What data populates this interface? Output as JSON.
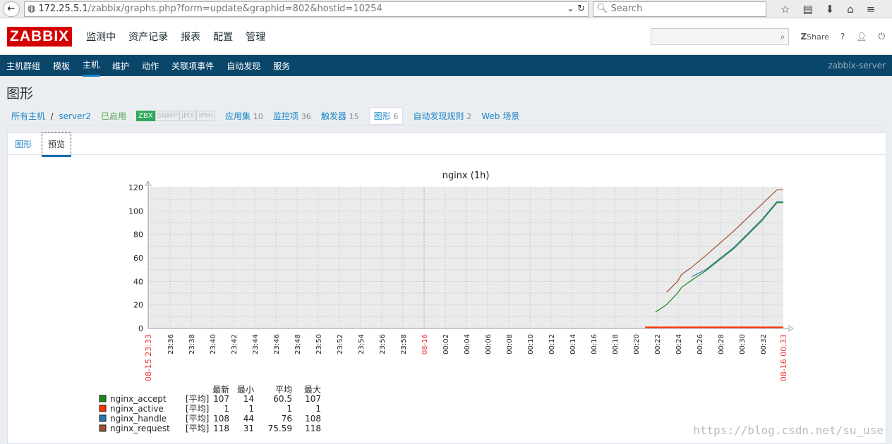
{
  "browser": {
    "url_host": "172.25.5.1",
    "url_path": "/zabbix/graphs.php?form=update&graphid=802&hostid=10254",
    "search_placeholder": "Search"
  },
  "header": {
    "logo": "ZABBIX",
    "menu": [
      "监测中",
      "资产记录",
      "报表",
      "配置",
      "管理"
    ],
    "share": "Share",
    "help": "?"
  },
  "submenu": {
    "items": [
      "主机群组",
      "模板",
      "主机",
      "维护",
      "动作",
      "关联项事件",
      "自动发现",
      "服务"
    ],
    "active": "主机",
    "server": "zabbix-server"
  },
  "page_title": "图形",
  "breadcrumb": {
    "all_hosts": "所有主机",
    "sep": "/",
    "host": "server2",
    "status": "已启用",
    "tags": [
      "ZBX",
      "SNMP",
      "JMX",
      "IPMI"
    ],
    "links": [
      {
        "label": "应用集",
        "count": "10"
      },
      {
        "label": "监控项",
        "count": "36"
      },
      {
        "label": "触发器",
        "count": "15"
      },
      {
        "label": "图形",
        "count": "6"
      },
      {
        "label": "自动发现规则",
        "count": "2"
      },
      {
        "label": "Web 场景",
        "count": ""
      }
    ]
  },
  "tabs": [
    "图形",
    "预览"
  ],
  "watermark": "https://blog.csdn.net/su_use",
  "chart_data": {
    "type": "line",
    "title": "nginx (1h)",
    "ylim": [
      0,
      120
    ],
    "yticks": [
      0,
      20,
      40,
      60,
      80,
      100,
      120
    ],
    "x_start": "08-15 23:33",
    "x_end": "08-16 00:33",
    "date_marker": "08-16",
    "xticks": [
      "23:36",
      "23:38",
      "23:40",
      "23:42",
      "23:44",
      "23:46",
      "23:48",
      "23:50",
      "23:52",
      "23:54",
      "23:56",
      "23:58",
      "00:02",
      "00:04",
      "00:06",
      "00:08",
      "00:10",
      "00:12",
      "00:14",
      "00:16",
      "00:18",
      "00:20",
      "00:22",
      "00:24",
      "00:26",
      "00:28",
      "00:30",
      "00:32"
    ],
    "grid": true,
    "legend_headers": [
      "最新",
      "最小",
      "平均",
      "最大"
    ],
    "series": [
      {
        "name": "nginx_accept",
        "color": "#1a8a1a",
        "func": "[平均]",
        "stats": [
          "107",
          "14",
          "60.5",
          "107"
        ],
        "points": [
          [
            "00:21:52",
            14
          ],
          [
            "00:22:52",
            20
          ],
          [
            "00:23:56",
            30
          ],
          [
            "00:24:20",
            35
          ],
          [
            "00:25:16",
            41
          ],
          [
            "00:26:36",
            49
          ],
          [
            "00:29:16",
            68
          ],
          [
            "00:31:56",
            92
          ],
          [
            "00:33:20",
            107
          ],
          [
            "00:33:56",
            107
          ]
        ]
      },
      {
        "name": "nginx_active",
        "color": "#ff3300",
        "func": "[平均]",
        "stats": [
          "1",
          "1",
          "1",
          "1"
        ],
        "points": [
          [
            "00:20:52",
            1
          ],
          [
            "00:33:56",
            1
          ]
        ]
      },
      {
        "name": "nginx_handle",
        "color": "#2a78b0",
        "func": "[平均]",
        "stats": [
          "108",
          "44",
          "76",
          "108"
        ],
        "points": [
          [
            "00:25:16",
            44
          ],
          [
            "00:26:36",
            50
          ],
          [
            "00:29:16",
            69
          ],
          [
            "00:31:56",
            93
          ],
          [
            "00:33:20",
            108
          ],
          [
            "00:33:56",
            108
          ]
        ]
      },
      {
        "name": "nginx_request",
        "color": "#a0522d",
        "func": "[平均]",
        "stats": [
          "118",
          "31",
          "75.59",
          "118"
        ],
        "points": [
          [
            "00:22:56",
            31
          ],
          [
            "00:23:56",
            40
          ],
          [
            "00:24:20",
            46
          ],
          [
            "00:25:16",
            52
          ],
          [
            "00:26:36",
            62
          ],
          [
            "00:29:16",
            83
          ],
          [
            "00:31:56",
            106
          ],
          [
            "00:33:20",
            118
          ],
          [
            "00:33:56",
            118
          ]
        ]
      }
    ]
  }
}
